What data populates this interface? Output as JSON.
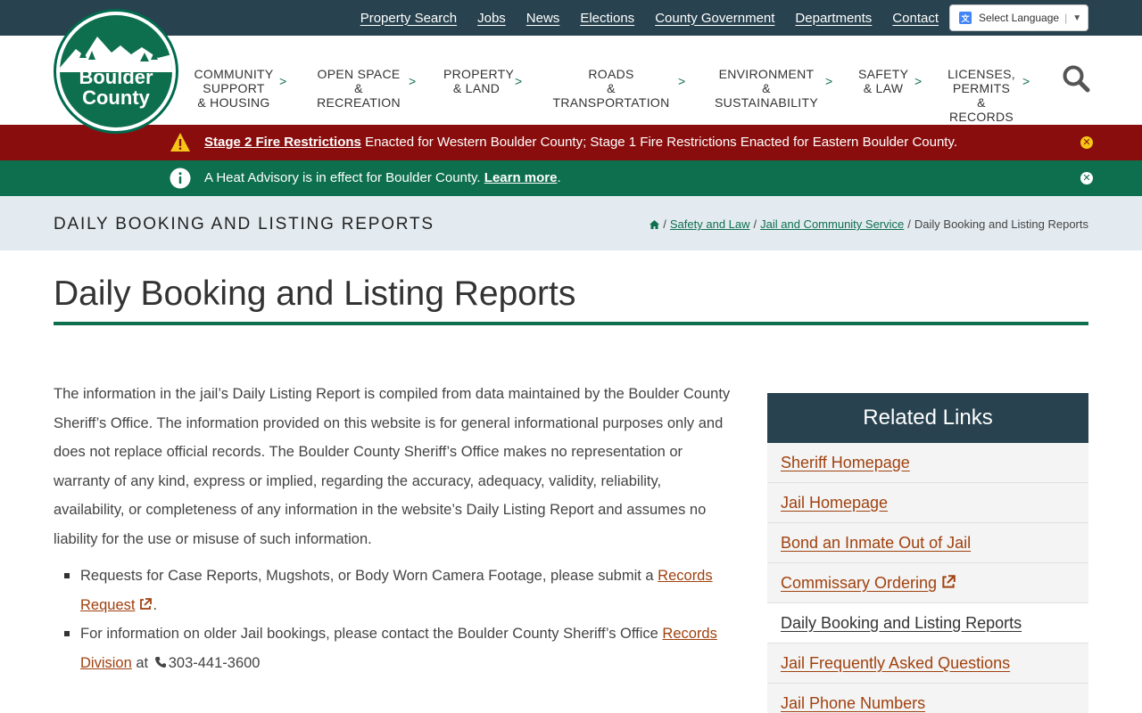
{
  "top_links": [
    "Property Search",
    "Jobs",
    "News",
    "Elections",
    "County Government",
    "Departments",
    "Contact"
  ],
  "language": {
    "label": "Select Language",
    "arrow": "▼"
  },
  "logo": {
    "line1": "Boulder",
    "line2": "County"
  },
  "nav": [
    {
      "lines": [
        "COMMUNITY",
        "SUPPORT",
        "& HOUSING"
      ]
    },
    {
      "lines": [
        "OPEN SPACE",
        "& RECREATION"
      ]
    },
    {
      "lines": [
        "PROPERTY",
        "& LAND"
      ]
    },
    {
      "lines": [
        "ROADS",
        "& TRANSPORTATION"
      ]
    },
    {
      "lines": [
        "ENVIRONMENT",
        "& SUSTAINABILITY"
      ]
    },
    {
      "lines": [
        "SAFETY",
        "& LAW"
      ]
    },
    {
      "lines": [
        "LICENSES,",
        "PERMITS",
        "& RECORDS"
      ]
    }
  ],
  "nav_chevron": ">",
  "alerts": {
    "fire": {
      "link": "Stage 2 Fire Restrictions",
      "text": " Enacted for Western Boulder County; Stage 1 Fire Restrictions Enacted for Eastern Boulder County."
    },
    "heat": {
      "text": "A Heat Advisory is in effect for Boulder County. ",
      "link": "Learn more",
      "tail": "."
    },
    "close_glyph": "✕"
  },
  "page_band": {
    "title": "DAILY BOOKING AND LISTING REPORTS",
    "breadcrumb": [
      "Safety and Law",
      "Jail and Community Service",
      "Daily Booking and Listing Reports"
    ],
    "separator": "/"
  },
  "heading": "Daily Booking and Listing Reports",
  "intro": "The information in the jail’s Daily Listing Report is compiled from data maintained by the Boulder County Sheriff’s Office. The information provided on this website is for general informational purposes only and does not replace official records. The Boulder County Sheriff’s Office makes no representation or warranty of any kind, express or implied, regarding the accuracy, adequacy, validity, reliability, availability, or completeness of any information in the website’s Daily Listing Report and assumes no liability for the use or misuse of such information.",
  "bullets": {
    "first": {
      "text": "Requests for Case Reports, Mugshots, or Body Worn Camera Footage, please submit a ",
      "link": "Records Request",
      "tail": "."
    },
    "second": {
      "text": "For information on older Jail bookings, please contact the Boulder County Sheriff’s Office ",
      "link": "Records Division",
      "mid": " at ",
      "phone": "303-441-3600"
    }
  },
  "sidebar": {
    "title": "Related Links",
    "items": [
      {
        "label": "Sheriff Homepage"
      },
      {
        "label": "Jail Homepage"
      },
      {
        "label": "Bond an Inmate Out of Jail"
      },
      {
        "label": "Commissary Ordering"
      },
      {
        "label": "Daily Booking and Listing Reports"
      },
      {
        "label": "Jail Frequently Asked Questions"
      },
      {
        "label": "Jail Phone Numbers"
      }
    ]
  },
  "colors": {
    "dark_blue": "#28424f",
    "green": "#0e6f4f",
    "red": "#8a0d0d",
    "link_orange": "#a0410e",
    "band": "#e4ebf0"
  }
}
